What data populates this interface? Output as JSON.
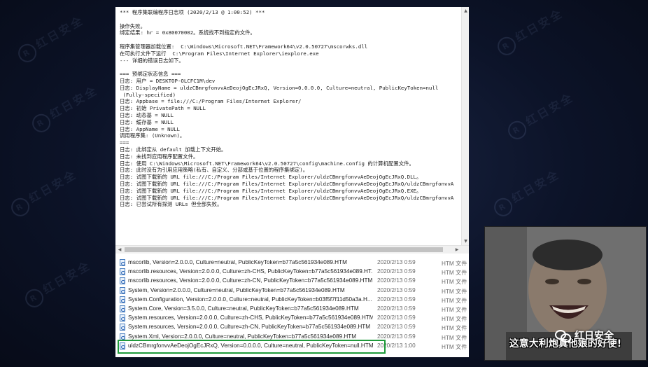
{
  "log": {
    "lines": [
      "*** 程序集联编程序日志项 (2020/2/13 @ 1:00:52) ***",
      "",
      "操作失败。",
      "绑定结果: hr = 0x80070002。系统找不到指定的文件。",
      "",
      "程序集管理器加载位置:  C:\\Windows\\Microsoft.NET\\Framework64\\v2.0.50727\\mscorwks.dll",
      "在可执行文件下运行  C:\\Program Files\\Internet Explorer\\iexplore.exe",
      "--- 详细的错误日志如下。",
      "",
      "=== 预绑定状态信息 ===",
      "日志: 用户 = DESKTOP-OLCFC1M\\dev",
      "日志: DisplayName = uldzCBmrgfonvvAeDeojOgEcJRxQ, Version=0.0.0.0, Culture=neutral, PublicKeyToken=null",
      " (Fully-specified)",
      "日志: Appbase = file:///C:/Program Files/Internet Explorer/",
      "日志: 初始 PrivatePath = NULL",
      "日志: 动态基 = NULL",
      "日志: 缓存基 = NULL",
      "日志: AppName = NULL",
      "调用程序集: (Unknown)。",
      "===",
      "日志: 此绑定从 default 加载上下文开始。",
      "日志: 未找到应用程序配置文件。",
      "日志: 使用 C:\\Windows\\Microsoft.NET\\Framework64\\v2.0.50727\\config\\machine.config 的计算机配置文件。",
      "日志: 此时没有为引用应用策略(私有、自定义、分部或基于位置的程序集绑定)。",
      "日志: 试图下载新的 URL file:///C:/Program Files/Internet Explorer/uldzCBmrgfonvvAeDeojOgEcJRxQ.DLL。",
      "日志: 试图下载新的 URL file:///C:/Program Files/Internet Explorer/uldzCBmrgfonvvAeDeojOgEcJRxQ/uldzCBmrgfonvvA",
      "日志: 试图下载新的 URL file:///C:/Program Files/Internet Explorer/uldzCBmrgfonvvAeDeojOgEcJRxQ.EXE。",
      "日志: 试图下载新的 URL file:///C:/Program Files/Internet Explorer/uldzCBmrgfonvvAeDeojOgEcJRxQ/uldzCBmrgfonvvA",
      "日志: 已尝试所有探测 URLs 但全部失败。"
    ]
  },
  "files": [
    {
      "name": "mscorlib, Version=2.0.0.0, Culture=neutral, PublicKeyToken=b77a5c561934e089.HTM",
      "date": "2020/2/13 0:59",
      "type": "HTM 文件"
    },
    {
      "name": "mscorlib.resources, Version=2.0.0.0, Culture=zh-CHS, PublicKeyToken=b77a5c561934e089.HT...",
      "date": "2020/2/13 0:59",
      "type": "HTM 文件"
    },
    {
      "name": "mscorlib.resources, Version=2.0.0.0, Culture=zh-CN, PublicKeyToken=b77a5c561934e089.HTM",
      "date": "2020/2/13 0:59",
      "type": "HTM 文件"
    },
    {
      "name": "System, Version=2.0.0.0, Culture=neutral, PublicKeyToken=b77a5c561934e089.HTM",
      "date": "2020/2/13 0:59",
      "type": "HTM 文件"
    },
    {
      "name": "System.Configuration, Version=2.0.0.0, Culture=neutral, PublicKeyToken=b03f5f7f11d50a3a.H...",
      "date": "2020/2/13 0:59",
      "type": "HTM 文件"
    },
    {
      "name": "System.Core, Version=3.5.0.0, Culture=neutral, PublicKeyToken=b77a5c561934e089.HTM",
      "date": "2020/2/13 0:59",
      "type": "HTM 文件"
    },
    {
      "name": "System.resources, Version=2.0.0.0, Culture=zh-CHS, PublicKeyToken=b77a5c561934e089.HTM",
      "date": "2020/2/13 0:59",
      "type": "HTM 文件"
    },
    {
      "name": "System.resources, Version=2.0.0.0, Culture=zh-CN, PublicKeyToken=b77a5c561934e089.HTM",
      "date": "2020/2/13 0:59",
      "type": "HTM 文件"
    },
    {
      "name": "System.Xml, Version=2.0.0.0, Culture=neutral, PublicKeyToken=b77a5c561934e089.HTM",
      "date": "2020/2/13 0:59",
      "type": "HTM 文件"
    },
    {
      "name": "uldzCBmrgfonvvAeDeojOgEcJRxQ, Version=0.0.0.0, Culture=neutral, PublicKeyToken=null.HTM",
      "date": "2020/2/13 1:00",
      "type": "HTM 文件"
    }
  ],
  "meme": {
    "caption": "这意大利炮真他娘的好使!"
  },
  "brand": {
    "name": "红日安全"
  },
  "watermark": {
    "text": "红日安全"
  },
  "colors": {
    "highlight": "#1f9a3a",
    "background": "#0c1328"
  }
}
